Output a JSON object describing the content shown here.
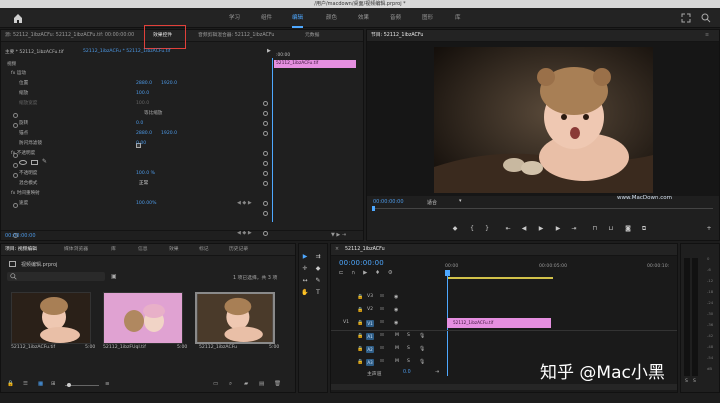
{
  "window": {
    "title": "/用户/macdown/桌面/视频编辑.prproj *"
  },
  "menu": {
    "tabs": [
      "学习",
      "组件",
      "编辑",
      "颜色",
      "效果",
      "音频",
      "图形",
      "库"
    ],
    "active": "编辑"
  },
  "source_panel": {
    "tabs": [
      "源: 52112_1ibzACFu: 52112_1ibzACFu.tif: 00:00:00:00",
      "效果控件",
      "音频剪辑混合器: 52112_1ibzACFu",
      "元数据"
    ],
    "active": "效果控件",
    "master_label": "主要 * 52112_1ibzACFu.tif",
    "clip_label": "52112_1ibzACFu * 52112_1ibzACFu.tif",
    "mini_time": ":00:00",
    "mini_clip": "52112_1ibzACFu.tif",
    "rows": [
      {
        "label": "视频",
        "v1": "",
        "v2": ""
      },
      {
        "label": "fx 运动",
        "v1": "",
        "v2": ""
      },
      {
        "label": "位置",
        "v1": "2880.0",
        "v2": "1920.0"
      },
      {
        "label": "缩放",
        "v1": "100.0",
        "v2": ""
      },
      {
        "label": "缩放宽度",
        "v1": "100.0",
        "v2": ""
      },
      {
        "label": "等比缩放",
        "v1": "",
        "v2": ""
      },
      {
        "label": "旋转",
        "v1": "0.0",
        "v2": ""
      },
      {
        "label": "锚点",
        "v1": "2880.0",
        "v2": "1920.0"
      },
      {
        "label": "防闪烁滤镜",
        "v1": "0.00",
        "v2": ""
      },
      {
        "label": "fx 不透明度",
        "v1": "",
        "v2": ""
      },
      {
        "label": "",
        "v1": "",
        "v2": ""
      },
      {
        "label": "不透明度",
        "v1": "100.0 %",
        "v2": ""
      },
      {
        "label": "混合模式",
        "v1": "正常",
        "v2": ""
      },
      {
        "label": "fx 时间重映射",
        "v1": "",
        "v2": ""
      },
      {
        "label": "速度",
        "v1": "100.00%",
        "v2": ""
      }
    ],
    "timecode": "00:00:00:00"
  },
  "program_panel": {
    "title": "节目: 52112_1ibzACFu",
    "timecode": "00:00:00:00",
    "fit": "适合",
    "ratio": "完整",
    "duration": "00:00:05:00",
    "watermark": "www.MacDown.com",
    "controls": [
      "marker",
      "in",
      "out",
      "goto-in",
      "step-back",
      "play",
      "step-forward",
      "goto-out",
      "lift",
      "extract",
      "export-frame",
      "compare",
      "add"
    ]
  },
  "project_panel": {
    "tabs": [
      "项目: 视频编辑",
      "媒体浏览器",
      "库",
      "信息",
      "效果",
      "标记",
      "历史记录"
    ],
    "active": "项目: 视频编辑",
    "file": "视频编辑.prproj",
    "search_placeholder": "",
    "selection": "1 项已选择，共 3 项",
    "items": [
      {
        "name": "52112_1ibzACFu.tif",
        "duration": "5:00"
      },
      {
        "name": "52112_1ibzFUqI.tif",
        "duration": "5:00"
      },
      {
        "name": "52112_1ibzACFu",
        "duration": "5:00"
      }
    ]
  },
  "timeline_panel": {
    "sequence": "52112_1ibzACFu",
    "timecode": "00:00:00:00",
    "ruler": [
      "00:00",
      "00:00:05:00",
      "00:00:10:"
    ],
    "tracks": [
      "V3",
      "V2",
      "V1",
      "A1",
      "A2",
      "A3"
    ],
    "master": "主声道",
    "master_value": "0.0",
    "clip": "52112_1ibzACFu.tif",
    "meter_ticks": [
      "0",
      "-6",
      "-12",
      "-18",
      "-24",
      "-30",
      "-36",
      "-42",
      "-48",
      "-54",
      "dB"
    ],
    "meter_footer": [
      "S",
      "S"
    ]
  },
  "overlay": {
    "text": "知乎 @Mac小黑"
  },
  "colors": {
    "accent": "#4ea8ff",
    "clip": "#e58fe0",
    "highlight_box": "#e2403a"
  }
}
